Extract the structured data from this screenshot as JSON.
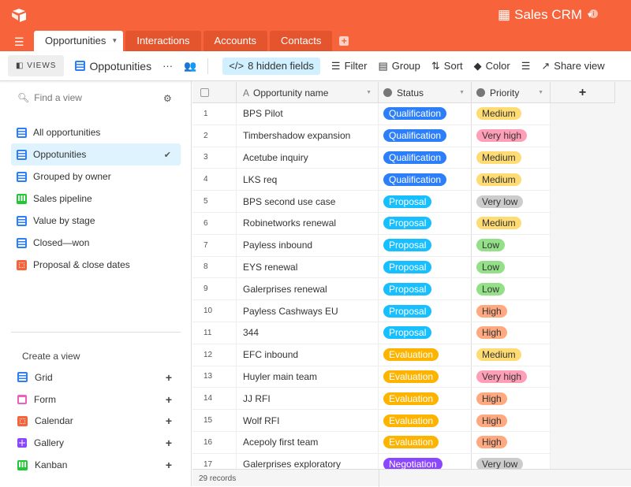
{
  "app": {
    "base_name": "Sales CRM",
    "logo": "airtable-logo",
    "colors": {
      "brand": "#f7643b",
      "selected_view": "#def3fd",
      "hidden_fields_bg": "#d1f0ff"
    }
  },
  "tabs": [
    {
      "label": "Opportunities",
      "active": true
    },
    {
      "label": "Interactions"
    },
    {
      "label": "Accounts"
    },
    {
      "label": "Contacts"
    }
  ],
  "toolbar": {
    "views": "VIEWS",
    "view_name": "Oppotunities",
    "more": "···",
    "hidden_fields": "8 hidden fields",
    "filter": "Filter",
    "group": "Group",
    "sort": "Sort",
    "color": "Color",
    "share": "Share view"
  },
  "sidebar": {
    "search_placeholder": "Find a view",
    "views": [
      {
        "label": "All opportunities",
        "icon": "grid-icon"
      },
      {
        "label": "Oppotunities",
        "icon": "grid-icon",
        "selected": true
      },
      {
        "label": "Grouped by owner",
        "icon": "grid-icon"
      },
      {
        "label": "Sales pipeline",
        "icon": "kanban-icon"
      },
      {
        "label": "Value by stage",
        "icon": "grid-icon"
      },
      {
        "label": "Closed—won",
        "icon": "grid-icon"
      },
      {
        "label": "Proposal & close dates",
        "icon": "calendar-icon"
      }
    ],
    "create_title": "Create a view",
    "create": [
      {
        "label": "Grid",
        "icon": "grid-icon"
      },
      {
        "label": "Form",
        "icon": "form-icon"
      },
      {
        "label": "Calendar",
        "icon": "calendar-icon"
      },
      {
        "label": "Gallery",
        "icon": "gallery-icon"
      },
      {
        "label": "Kanban",
        "icon": "kanban-icon"
      }
    ]
  },
  "grid": {
    "columns": [
      "Opportunity name",
      "Status",
      "Priority"
    ],
    "add": "+",
    "status_colors": {
      "Qualification": "#2d7ff9",
      "Proposal": "#18bfff",
      "Evaluation": "#fcb400",
      "Negotiation": "#8b46ff"
    },
    "priority_colors": {
      "Medium": "#ffdc73",
      "Very high": "#ff9eb7",
      "Very low": "#cccccc",
      "Low": "#93e088",
      "High": "#ffa981"
    },
    "rows": [
      {
        "n": "1",
        "name": "BPS Pilot",
        "status": "Qualification",
        "priority": "Medium"
      },
      {
        "n": "2",
        "name": "Timbershadow expansion",
        "status": "Qualification",
        "priority": "Very high"
      },
      {
        "n": "3",
        "name": "Acetube inquiry",
        "status": "Qualification",
        "priority": "Medium"
      },
      {
        "n": "4",
        "name": "LKS req",
        "status": "Qualification",
        "priority": "Medium"
      },
      {
        "n": "5",
        "name": "BPS second use case",
        "status": "Proposal",
        "priority": "Very low"
      },
      {
        "n": "6",
        "name": "Robinetworks renewal",
        "status": "Proposal",
        "priority": "Medium"
      },
      {
        "n": "7",
        "name": "Payless inbound",
        "status": "Proposal",
        "priority": "Low"
      },
      {
        "n": "8",
        "name": "EYS renewal",
        "status": "Proposal",
        "priority": "Low"
      },
      {
        "n": "9",
        "name": "Galerprises renewal",
        "status": "Proposal",
        "priority": "Low"
      },
      {
        "n": "10",
        "name": "Payless Cashways EU",
        "status": "Proposal",
        "priority": "High"
      },
      {
        "n": "11",
        "name": "344",
        "status": "Proposal",
        "priority": "High"
      },
      {
        "n": "12",
        "name": "EFC inbound",
        "status": "Evaluation",
        "priority": "Medium"
      },
      {
        "n": "13",
        "name": "Huyler main team",
        "status": "Evaluation",
        "priority": "Very high"
      },
      {
        "n": "14",
        "name": "JJ RFI",
        "status": "Evaluation",
        "priority": "High"
      },
      {
        "n": "15",
        "name": "Wolf RFI",
        "status": "Evaluation",
        "priority": "High"
      },
      {
        "n": "16",
        "name": "Acepoly first team",
        "status": "Evaluation",
        "priority": "High"
      },
      {
        "n": "17",
        "name": "Galerprises exploratory",
        "status": "Negotiation",
        "priority": "Very low"
      }
    ],
    "record_count": "29 records"
  }
}
